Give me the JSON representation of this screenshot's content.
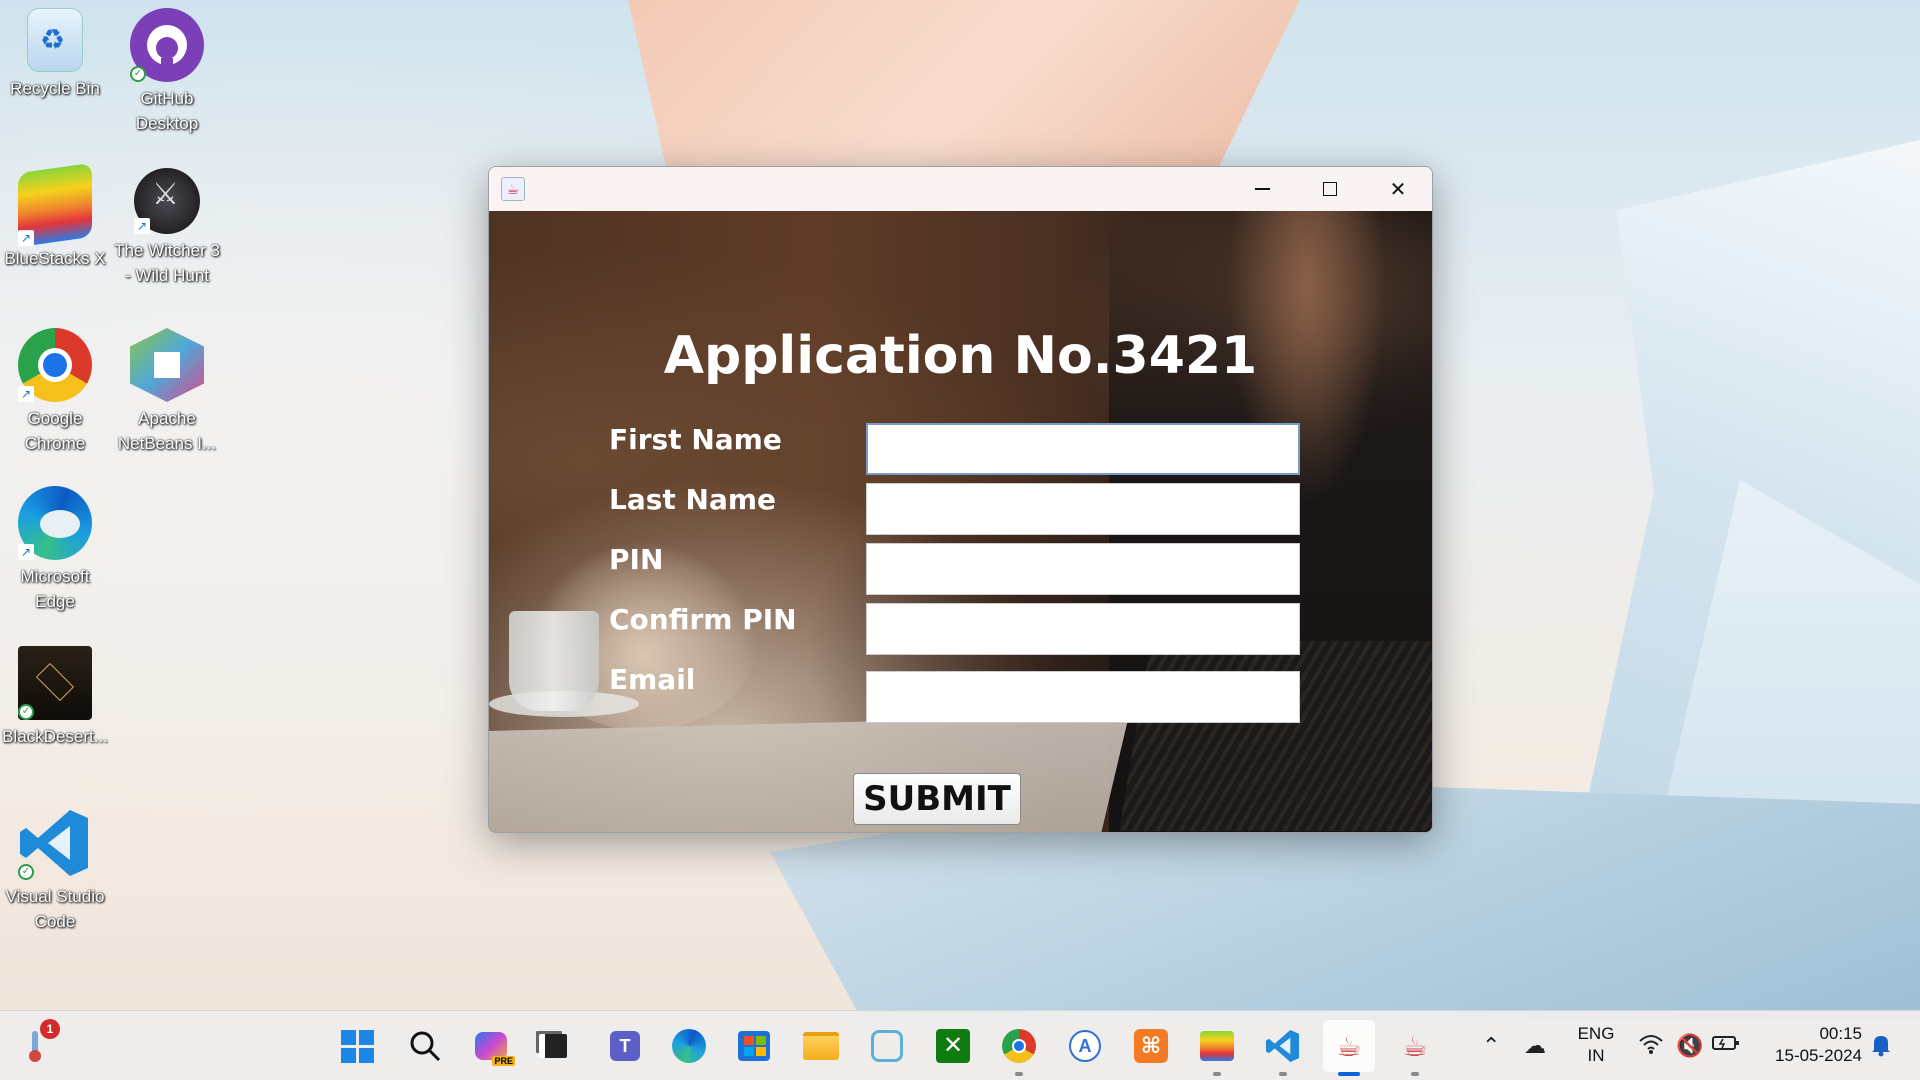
{
  "desktop": {
    "icons": [
      {
        "label": "Recycle Bin",
        "icon": "recycle-bin-icon"
      },
      {
        "label": "GitHub Desktop",
        "icon": "github-desktop-icon"
      },
      {
        "label": "BlueStacks X",
        "icon": "bluestacks-icon"
      },
      {
        "label": "The Witcher 3 - Wild Hunt",
        "icon": "witcher-icon"
      },
      {
        "label": "Google Chrome",
        "icon": "chrome-icon"
      },
      {
        "label": "Apache NetBeans I...",
        "icon": "netbeans-icon"
      },
      {
        "label": "Microsoft Edge",
        "icon": "edge-icon"
      },
      {
        "label": "BlackDesert...",
        "icon": "black-desert-icon"
      },
      {
        "label": "Visual Studio Code",
        "icon": "vscode-icon"
      }
    ]
  },
  "window": {
    "app_icon_glyph": "☕",
    "controls": {
      "minimize": "minimize",
      "maximize": "maximize",
      "close": "✕"
    }
  },
  "form": {
    "title": "Application No.3421",
    "fields": [
      {
        "label": "First Name",
        "value": ""
      },
      {
        "label": "Last Name",
        "value": ""
      },
      {
        "label": "PIN",
        "value": ""
      },
      {
        "label": "Confirm PIN",
        "value": ""
      },
      {
        "label": "Email",
        "value": ""
      }
    ],
    "submit_label": "SUBMIT"
  },
  "taskbar": {
    "weather_badge": "1",
    "language": {
      "line1": "ENG",
      "line2": "IN"
    },
    "clock": {
      "time": "00:15",
      "date": "15-05-2024"
    },
    "copilot_badge": "PRE",
    "colors": {
      "accent": "#0a64d6",
      "badge": "#d12b2b"
    }
  }
}
